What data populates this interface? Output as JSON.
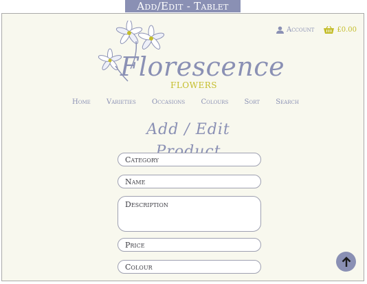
{
  "caption": "Add/Edit - Tablet",
  "brand": {
    "name": "Florescence",
    "sub": "FLOWERS"
  },
  "header": {
    "account": "Account",
    "basket": "£0.00"
  },
  "nav": [
    "Home",
    "Varieties",
    "Occasions",
    "Colours",
    "Sort",
    "Search"
  ],
  "form": {
    "title": "Add / Edit Product",
    "category_placeholder": "Category",
    "name_placeholder": "Name",
    "description_placeholder": "Description",
    "price_placeholder": "Price",
    "colour_placeholder": "Colour"
  },
  "colors": {
    "accent": "#8a90b4",
    "brand_gold": "#c4bd2a",
    "background": "#f8f8ee"
  },
  "icons": [
    "flower-logo-icon",
    "account-icon",
    "basket-icon",
    "arrow-up-icon"
  ]
}
